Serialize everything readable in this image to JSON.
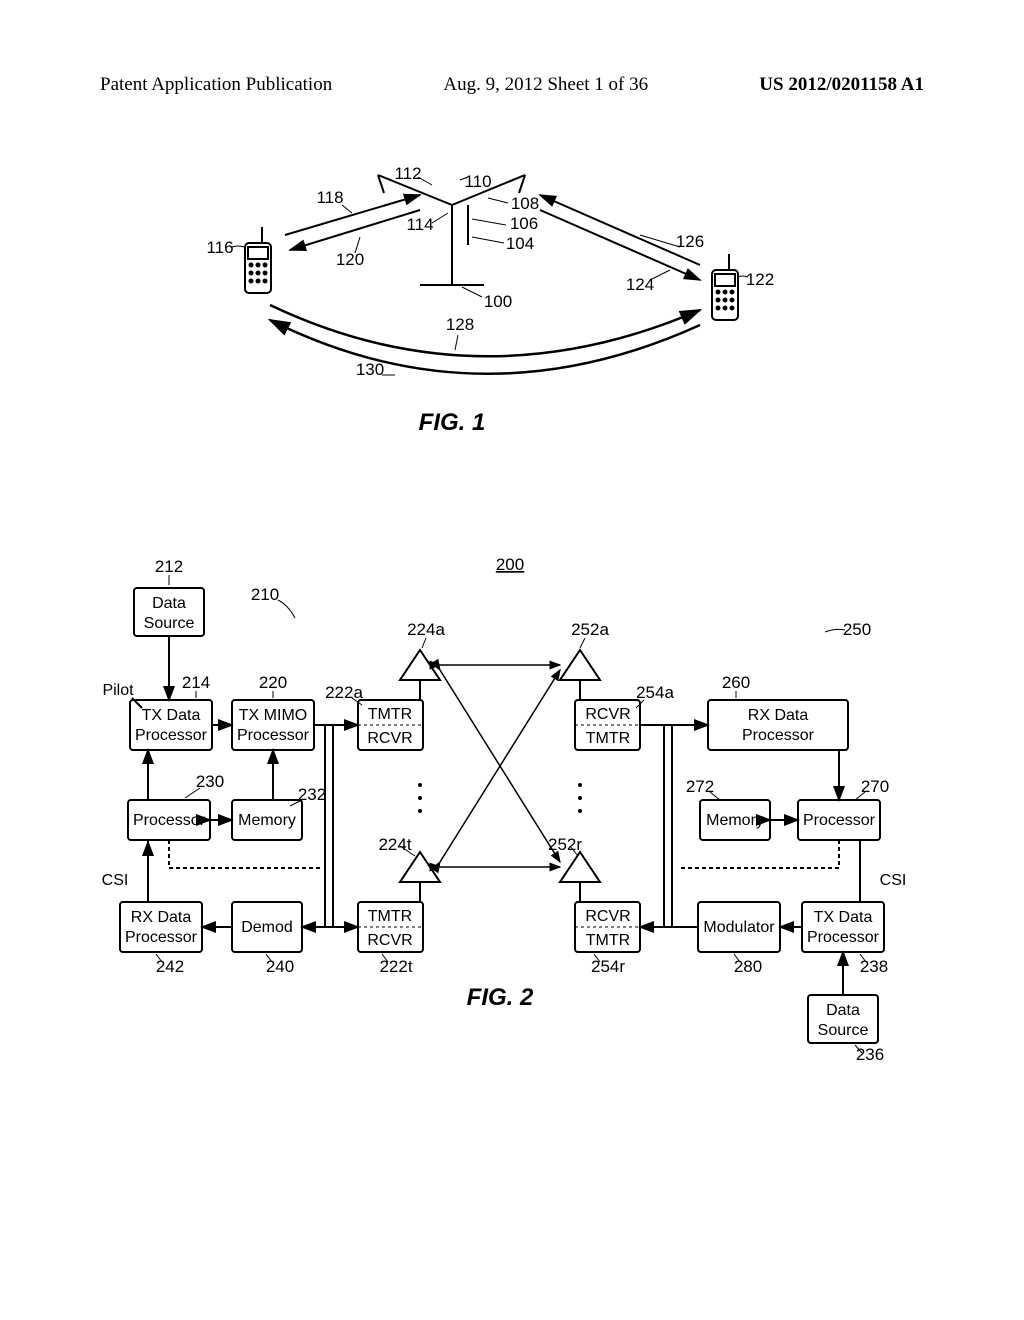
{
  "header": {
    "left": "Patent Application Publication",
    "center": "Aug. 9, 2012  Sheet 1 of 36",
    "right": "US 2012/0201158 A1"
  },
  "fig1": {
    "caption": "FIG. 1",
    "labels": {
      "n116": "116",
      "n118": "118",
      "n120": "120",
      "n112": "112",
      "n114": "114",
      "n110": "110",
      "n108": "108",
      "n106": "106",
      "n104": "104",
      "n100": "100",
      "n128": "128",
      "n130": "130",
      "n124": "124",
      "n126": "126",
      "n122": "122"
    }
  },
  "fig2": {
    "caption": "FIG. 2",
    "system_ref": "200",
    "left_side_ref": "210",
    "right_side_ref": "250",
    "blocks": {
      "data_source_212": {
        "ref": "212",
        "line1": "Data",
        "line2": "Source"
      },
      "tx_data_214": {
        "ref": "214",
        "line1": "TX Data",
        "line2": "Processor"
      },
      "tx_mimo_220": {
        "ref": "220",
        "line1": "TX MIMO",
        "line2": "Processor"
      },
      "tmtr_rcvr_222a": {
        "ref": "222a",
        "line1": "TMTR",
        "line2": "RCVR"
      },
      "tmtr_rcvr_222t": {
        "ref": "222t",
        "line1": "TMTR",
        "line2": "RCVR"
      },
      "processor_230": {
        "ref": "230",
        "text": "Processor"
      },
      "memory_232": {
        "ref": "232",
        "text": "Memory"
      },
      "rx_data_242": {
        "ref": "242",
        "line1": "RX Data",
        "line2": "Processor"
      },
      "demod_240": {
        "ref": "240",
        "text": "Demod"
      },
      "antenna_224a": {
        "ref": "224a"
      },
      "antenna_224t": {
        "ref": "224t"
      },
      "antenna_252a": {
        "ref": "252a"
      },
      "antenna_252r": {
        "ref": "252r"
      },
      "rcvr_tmtr_254a": {
        "ref": "254a",
        "line1": "RCVR",
        "line2": "TMTR"
      },
      "rcvr_tmtr_254r": {
        "ref": "254r",
        "line1": "RCVR",
        "line2": "TMTR"
      },
      "rx_data_260": {
        "ref": "260",
        "line1": "RX Data",
        "line2": "Processor"
      },
      "memory_272": {
        "ref": "272",
        "text": "Memory"
      },
      "processor_270": {
        "ref": "270",
        "text": "Processor"
      },
      "modulator_280": {
        "ref": "280",
        "text": "Modulator"
      },
      "tx_data_238": {
        "ref": "238",
        "line1": "TX Data",
        "line2": "Processor"
      },
      "data_source_236": {
        "ref": "236",
        "line1": "Data",
        "line2": "Source"
      }
    },
    "labels": {
      "pilot": "Pilot",
      "csi_left": "CSI",
      "csi_right": "CSI"
    }
  }
}
